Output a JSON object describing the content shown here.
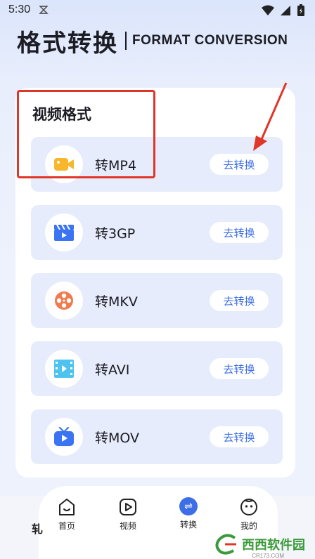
{
  "status_bar": {
    "time": "5:30"
  },
  "header": {
    "title_cn": "格式转换",
    "title_en": "FORMAT CONVERSION"
  },
  "section": {
    "title": "视频格式"
  },
  "formats": [
    {
      "label": "转MP4",
      "button": "去转换",
      "icon": "video-camera-icon",
      "icon_color": "#f8b62c"
    },
    {
      "label": "转3GP",
      "button": "去转换",
      "icon": "clapperboard-icon",
      "icon_color": "#3b74f2"
    },
    {
      "label": "转MKV",
      "button": "去转换",
      "icon": "film-reel-icon",
      "icon_color": "#f27a4c"
    },
    {
      "label": "转AVI",
      "button": "去转换",
      "icon": "film-strip-icon",
      "icon_color": "#4ec3f0"
    },
    {
      "label": "转MOV",
      "button": "去转换",
      "icon": "tv-play-icon",
      "icon_color": "#3b74f2"
    }
  ],
  "bottom_nav": {
    "items": [
      {
        "label": "首页",
        "icon": "home-icon"
      },
      {
        "label": "视频",
        "icon": "play-icon"
      },
      {
        "label": "转换",
        "icon": "convert-icon",
        "active": true
      },
      {
        "label": "我的",
        "icon": "profile-face-icon"
      }
    ],
    "left_glyph": "轧"
  },
  "watermark": {
    "brand": "西西软件园",
    "url": "CR173.COM"
  },
  "colors": {
    "accent": "#3d6ee8",
    "annotation": "#e0362a",
    "row_bg": "#e6ecfb"
  }
}
